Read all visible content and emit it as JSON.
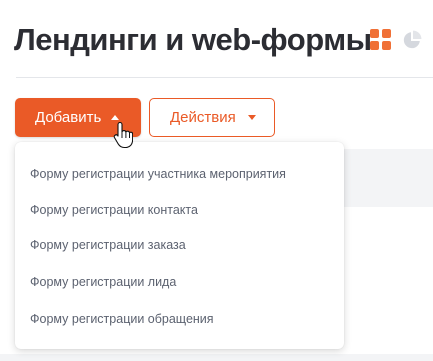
{
  "page": {
    "title": "Лендинги и web-формы"
  },
  "view_switcher": {
    "active": "grid-view-icon",
    "inactive": "pie-chart-icon",
    "accent_color": "#f07036",
    "inactive_color": "#d5d8de"
  },
  "toolbar": {
    "add_label": "Добавить",
    "actions_label": "Действия",
    "primary_color": "#ea5a27"
  },
  "add_menu": {
    "items": [
      "Форму регистрации участника мероприятия",
      "Форму регистрации контакта",
      "Форму регистрации заказа",
      "Форму регистрации лида",
      "Форму регистрации обращения"
    ]
  }
}
